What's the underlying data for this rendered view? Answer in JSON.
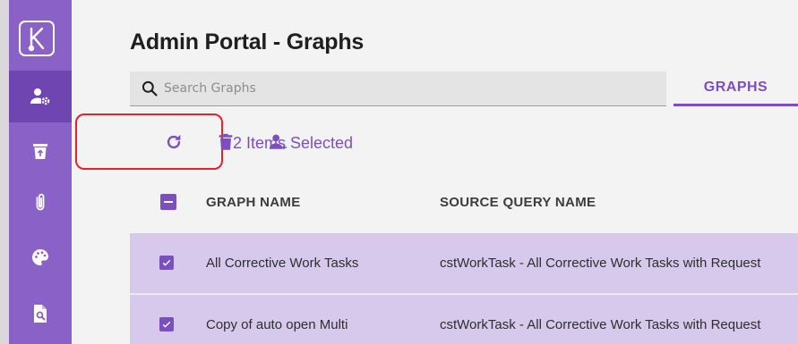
{
  "page": {
    "title": "Admin Portal - Graphs"
  },
  "search": {
    "placeholder": "Search Graphs",
    "value": ""
  },
  "tabs": [
    {
      "label": "GRAPHS",
      "active": true
    }
  ],
  "toolbar": {
    "selected_count_text": "2 Items Selected",
    "icons": [
      "refresh-icon",
      "delete-icon",
      "assign-user-icon"
    ]
  },
  "sidebar": {
    "logo": "k-logo-icon",
    "items": [
      {
        "icon": "user-settings-icon",
        "active": true
      },
      {
        "icon": "trash-icon",
        "active": false
      },
      {
        "icon": "paperclip-icon",
        "active": false
      },
      {
        "icon": "palette-icon",
        "active": false
      },
      {
        "icon": "document-search-icon",
        "active": false
      }
    ]
  },
  "table": {
    "columns": [
      "GRAPH NAME",
      "SOURCE QUERY NAME"
    ],
    "rows": [
      {
        "checked": true,
        "graph_name": "All Corrective Work Tasks",
        "source_query": "cstWorkTask - All Corrective Work Tasks with Request"
      },
      {
        "checked": true,
        "graph_name": "Copy of auto open Multi",
        "source_query": "cstWorkTask - All Corrective Work Tasks with Request"
      }
    ]
  },
  "colors": {
    "sidebar": "#8a62c7",
    "sidebar_active": "#6f45b2",
    "accent": "#7b4fc0",
    "selected_row": "#d7c9ec",
    "highlight_outline": "#e8212a"
  }
}
